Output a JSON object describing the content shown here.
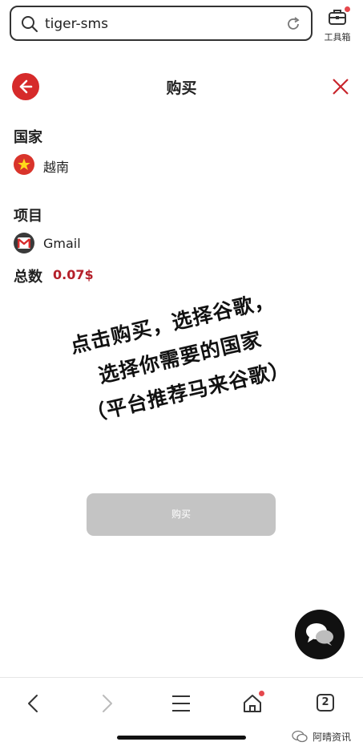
{
  "browser": {
    "url": "tiger-sms",
    "toolbox_label": "工具箱"
  },
  "page": {
    "title": "购买"
  },
  "form": {
    "country_label": "国家",
    "country_value": "越南",
    "project_label": "项目",
    "project_value": "Gmail",
    "total_label": "总数",
    "total_value": "0.07$"
  },
  "annotation": {
    "lines": [
      "点击购买，选择谷歌，",
      "选择你需要的国家",
      "（平台推荐马来谷歌）"
    ]
  },
  "buy_button": {
    "label": "购买"
  },
  "bottom_nav": {
    "tabs_count": "2"
  },
  "watermark": {
    "text": "阿晴资讯"
  },
  "colors": {
    "accent_red": "#d62a2a",
    "price_red": "#b5202a",
    "button_disabled": "#c4c4c4"
  }
}
